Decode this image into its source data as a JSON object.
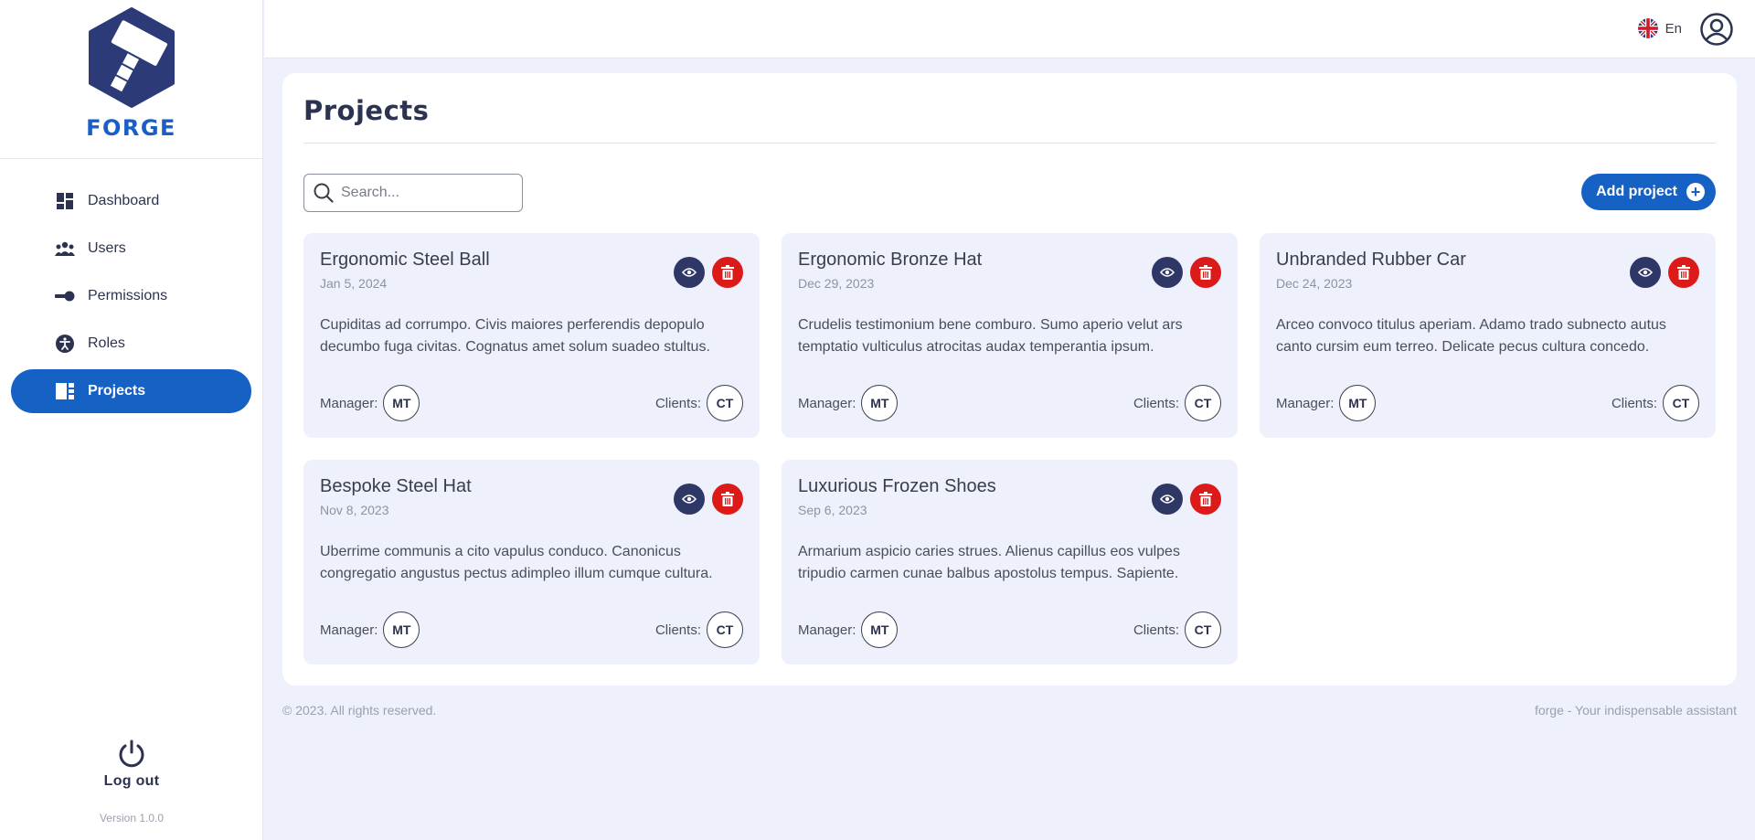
{
  "brand": {
    "name": "FORGE"
  },
  "sidebar": {
    "items": [
      {
        "label": "Dashboard",
        "icon": "dashboard-icon"
      },
      {
        "label": "Users",
        "icon": "users-icon"
      },
      {
        "label": "Permissions",
        "icon": "key-icon"
      },
      {
        "label": "Roles",
        "icon": "accessibility-icon"
      },
      {
        "label": "Projects",
        "icon": "projects-icon",
        "active": true
      }
    ],
    "logout_label": "Log out",
    "version": "Version 1.0.0"
  },
  "topbar": {
    "language": "En",
    "flag_icon": "uk-flag-icon",
    "profile_icon": "user-circle-icon"
  },
  "page": {
    "title": "Projects",
    "search_placeholder": "Search...",
    "add_button_label": "Add project"
  },
  "projects": [
    {
      "title": "Ergonomic Steel Ball",
      "date": "Jan 5, 2024",
      "description": "Cupiditas ad corrumpo. Civis maiores perferendis depopulo decumbo fuga civitas. Cognatus amet solum suadeo stultus.",
      "manager_label": "Manager:",
      "manager": "MT",
      "clients_label": "Clients:",
      "clients": "CT"
    },
    {
      "title": "Ergonomic Bronze Hat",
      "date": "Dec 29, 2023",
      "description": "Crudelis testimonium bene comburo. Sumo aperio velut ars temptatio vulticulus atrocitas audax temperantia ipsum.",
      "manager_label": "Manager:",
      "manager": "MT",
      "clients_label": "Clients:",
      "clients": "CT"
    },
    {
      "title": "Unbranded Rubber Car",
      "date": "Dec 24, 2023",
      "description": "Arceo convoco titulus aperiam. Adamo trado subnecto autus canto cursim eum terreo. Delicate pecus cultura concedo.",
      "manager_label": "Manager:",
      "manager": "MT",
      "clients_label": "Clients:",
      "clients": "CT"
    },
    {
      "title": "Bespoke Steel Hat",
      "date": "Nov 8, 2023",
      "description": "Uberrime communis a cito vapulus conduco. Canonicus congregatio angustus pectus adimpleo illum cumque culturа.",
      "manager_label": "Manager:",
      "manager": "MT",
      "clients_label": "Clients:",
      "clients": "CT"
    },
    {
      "title": "Luxurious Frozen Shoes",
      "date": "Sep 6, 2023",
      "description": "Armarium aspicio caries strues. Alienus capillus eos vulpes tripudio carmen cunae balbus apostolus tempus. Sapiente.",
      "manager_label": "Manager:",
      "manager": "MT",
      "clients_label": "Clients:",
      "clients": "CT"
    }
  ],
  "footer": {
    "copyright": "© 2023. All rights reserved.",
    "tagline": "forge - Your indispensable assistant"
  },
  "colors": {
    "accent": "#1561c4",
    "view_button": "#2f3767",
    "delete_button": "#dc1a1a",
    "background": "#eef0fb"
  }
}
